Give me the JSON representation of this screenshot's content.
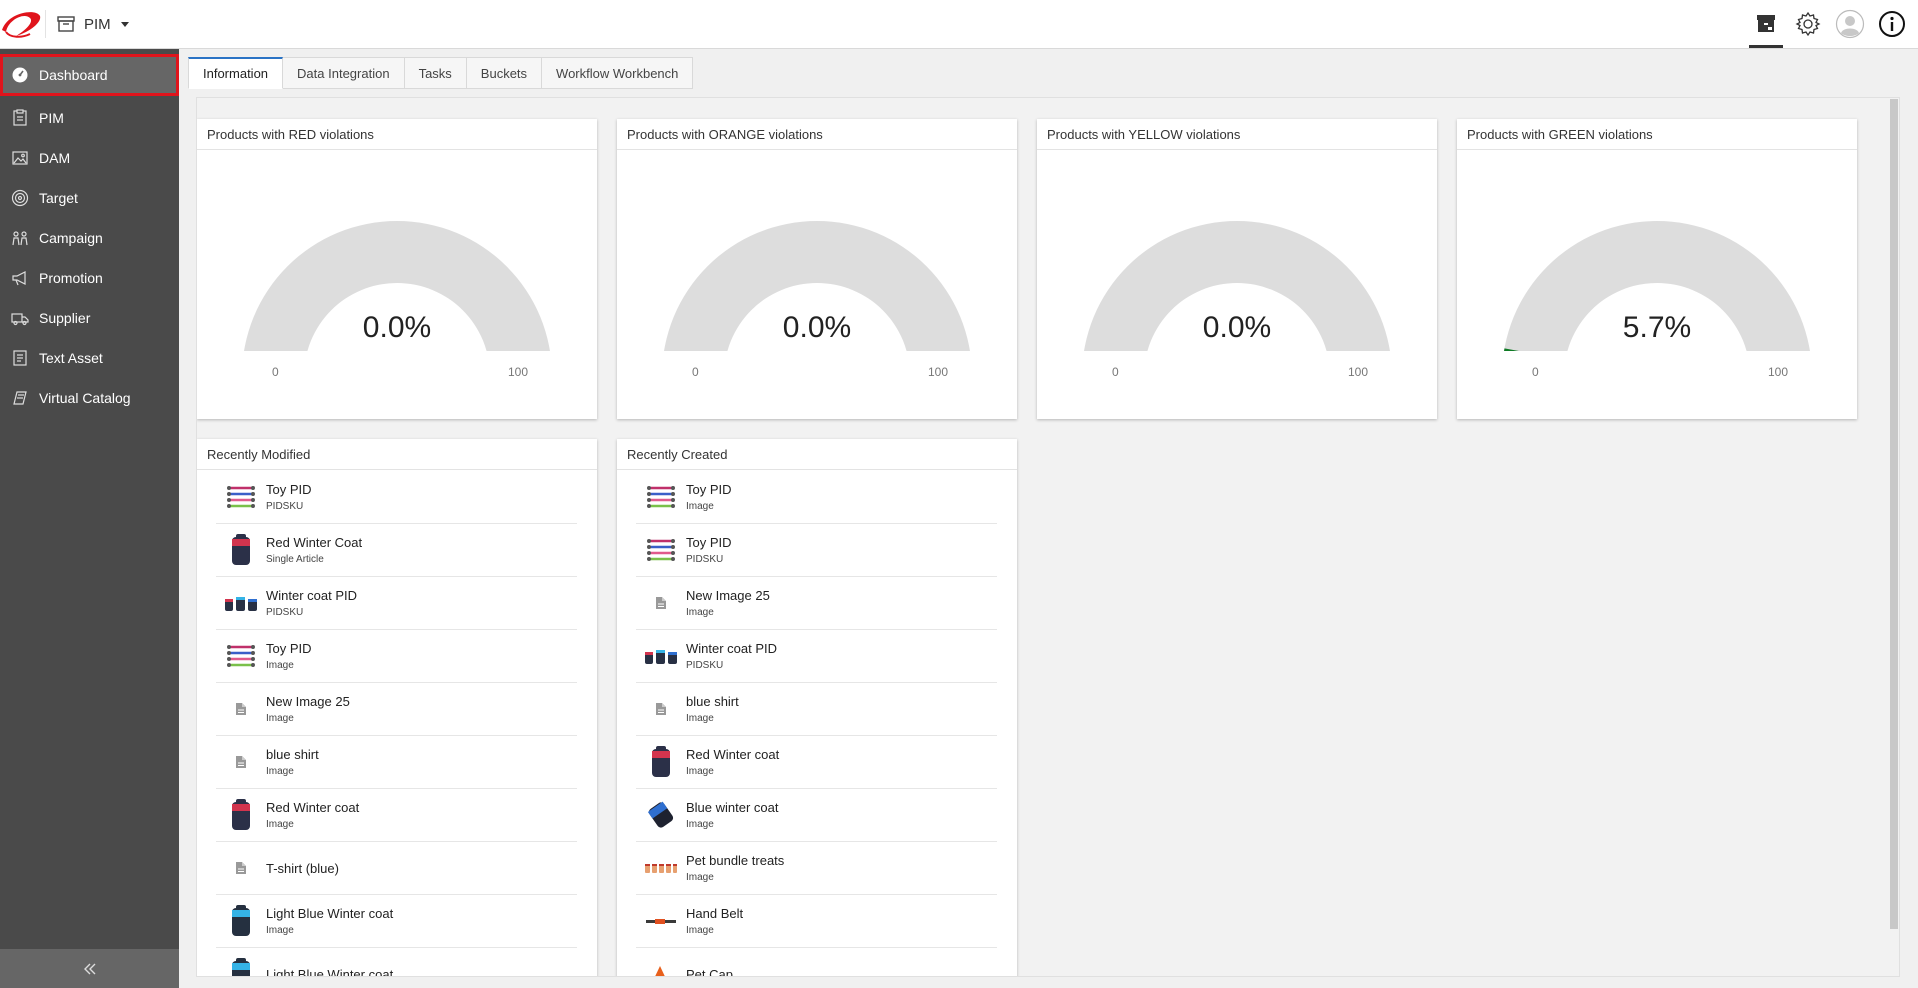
{
  "app": {
    "switcher_label": "PIM"
  },
  "colors": {
    "brand_red": "#e0141c",
    "sidebar_bg": "#4a4a4a",
    "tab_accent": "#2a73c5",
    "gauge_track": "#dddddd",
    "gauge_green": "#0e7a24"
  },
  "header_actions": [
    {
      "icon": "archive-icon"
    },
    {
      "icon": "gear-icon"
    },
    {
      "icon": "user-avatar-icon"
    },
    {
      "icon": "info-icon"
    }
  ],
  "sidebar": {
    "items": [
      {
        "label": "Dashboard",
        "icon": "dashboard-icon",
        "active": true
      },
      {
        "label": "PIM",
        "icon": "pim-icon"
      },
      {
        "label": "DAM",
        "icon": "dam-icon"
      },
      {
        "label": "Target",
        "icon": "target-icon"
      },
      {
        "label": "Campaign",
        "icon": "campaign-icon"
      },
      {
        "label": "Promotion",
        "icon": "megaphone-icon"
      },
      {
        "label": "Supplier",
        "icon": "truck-icon"
      },
      {
        "label": "Text Asset",
        "icon": "text-asset-icon"
      },
      {
        "label": "Virtual Catalog",
        "icon": "virtual-catalog-icon"
      }
    ],
    "collapse_icon": "double-chevron-left-icon"
  },
  "tabs": [
    {
      "label": "Information",
      "active": true
    },
    {
      "label": "Data Integration"
    },
    {
      "label": "Tasks"
    },
    {
      "label": "Buckets"
    },
    {
      "label": "Workflow Workbench"
    }
  ],
  "gauges": [
    {
      "title": "Products with RED violations",
      "value_text": "0.0%",
      "value": 0.0,
      "min": "0",
      "max": "100"
    },
    {
      "title": "Products with ORANGE violations",
      "value_text": "0.0%",
      "value": 0.0,
      "min": "0",
      "max": "100"
    },
    {
      "title": "Products with YELLOW violations",
      "value_text": "0.0%",
      "value": 0.0,
      "min": "0",
      "max": "100"
    },
    {
      "title": "Products with GREEN violations",
      "value_text": "5.7%",
      "value": 5.7,
      "min": "0",
      "max": "100"
    }
  ],
  "recently_modified": {
    "title": "Recently Modified",
    "items": [
      {
        "name": "Toy PID",
        "type": "PIDSKU",
        "thumb": "toy"
      },
      {
        "name": "Red Winter Coat",
        "type": "Single Article",
        "thumb": "coat-red"
      },
      {
        "name": "Winter coat PID",
        "type": "PIDSKU",
        "thumb": "coats-multi"
      },
      {
        "name": "Toy PID",
        "type": "Image",
        "thumb": "toy"
      },
      {
        "name": "New Image 25",
        "type": "Image",
        "thumb": "file"
      },
      {
        "name": "blue shirt",
        "type": "Image",
        "thumb": "file"
      },
      {
        "name": "Red Winter coat",
        "type": "Image",
        "thumb": "coat-red"
      },
      {
        "name": "T-shirt (blue)",
        "type": "",
        "thumb": "file"
      },
      {
        "name": "Light Blue Winter coat",
        "type": "Image",
        "thumb": "coat-lightblue"
      },
      {
        "name": "Light Blue Winter coat",
        "type": "",
        "thumb": "coat-lightblue"
      }
    ]
  },
  "recently_created": {
    "title": "Recently Created",
    "items": [
      {
        "name": "Toy PID",
        "type": "Image",
        "thumb": "toy"
      },
      {
        "name": "Toy PID",
        "type": "PIDSKU",
        "thumb": "toy"
      },
      {
        "name": "New Image 25",
        "type": "Image",
        "thumb": "file"
      },
      {
        "name": "Winter coat PID",
        "type": "PIDSKU",
        "thumb": "coats-multi"
      },
      {
        "name": "blue shirt",
        "type": "Image",
        "thumb": "file"
      },
      {
        "name": "Red Winter coat",
        "type": "Image",
        "thumb": "coat-red"
      },
      {
        "name": "Blue winter coat",
        "type": "Image",
        "thumb": "coat-blue"
      },
      {
        "name": "Pet bundle treats",
        "type": "Image",
        "thumb": "treats"
      },
      {
        "name": "Hand Belt",
        "type": "Image",
        "thumb": "belt"
      },
      {
        "name": "Pet Cap",
        "type": "",
        "thumb": "cap"
      }
    ]
  }
}
